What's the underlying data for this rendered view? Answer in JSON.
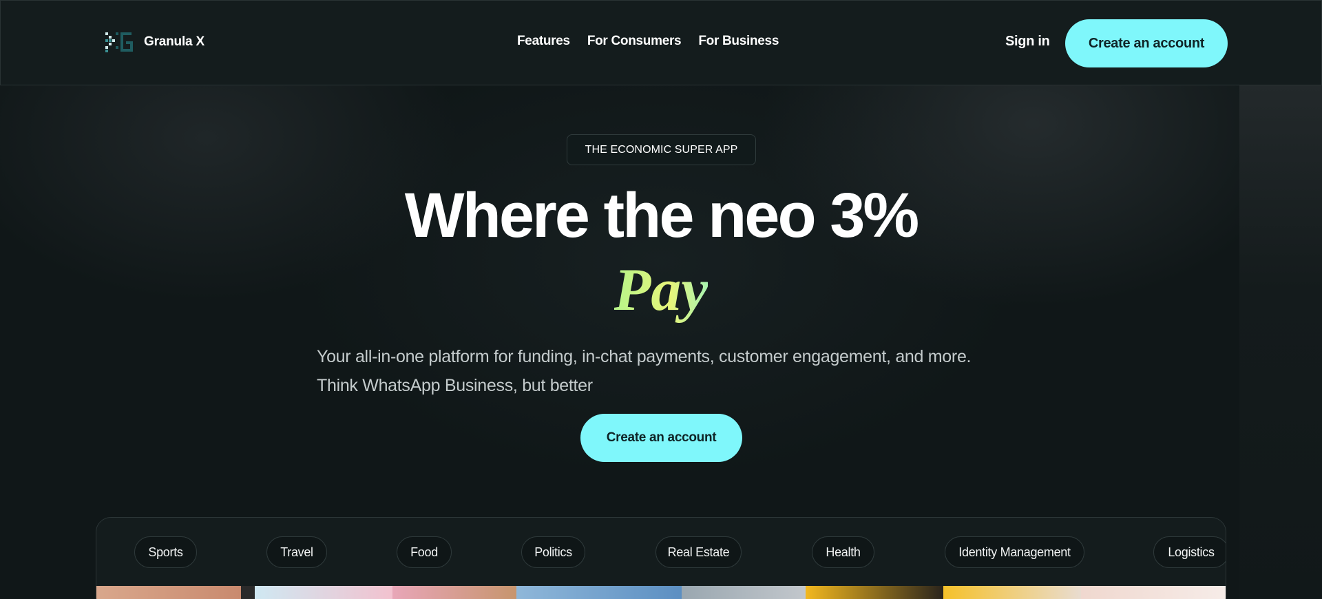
{
  "header": {
    "brand": "Granula X",
    "nav": [
      "Features",
      "For Consumers",
      "For Business"
    ],
    "signin": "Sign in",
    "cta": "Create an account"
  },
  "hero": {
    "eyebrow": "THE ECONOMIC SUPER APP",
    "headline": "Where the neo 3%",
    "accent_word": "Pay",
    "subtitle_line1": "Your all-in-one platform for funding, in-chat payments, customer engagement, and more.",
    "subtitle_line2": "Think WhatsApp Business, but better",
    "cta": "Create an account"
  },
  "categories": [
    "Sports",
    "Travel",
    "Food",
    "Politics",
    "Real Estate",
    "Health",
    "Identity Management",
    "Logistics"
  ],
  "colors": {
    "accent": "#7ff7fb",
    "background": "#101718",
    "pay_gradient_start": "#b6f58a",
    "pay_gradient_end": "#e7f57a"
  },
  "icons": {
    "logo": "granula-x-logo-icon"
  }
}
